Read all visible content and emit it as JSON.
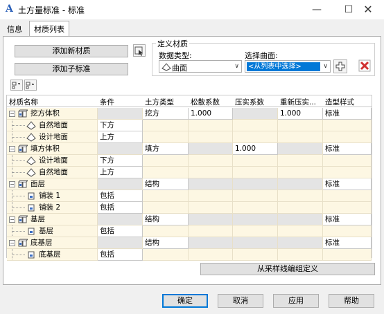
{
  "window": {
    "title": "土方量标准 - 标准",
    "min": "—",
    "max": "☐",
    "close": "✕"
  },
  "tabs": [
    {
      "label": "信息"
    },
    {
      "label": "材质列表"
    }
  ],
  "buttons": {
    "add_material": "添加新材质",
    "add_sub": "添加子标准",
    "define_from_sample": "从采样线编组定义"
  },
  "define": {
    "group_label": "定义材质",
    "datatype_label": "数据类型:",
    "datatype_value": "曲面",
    "select_label": "选择曲面:",
    "select_value": "<从列表中选择>"
  },
  "columns": [
    "材质名称",
    "条件",
    "土方类型",
    "松散系数",
    "压实系数",
    "重新压实...",
    "造型样式"
  ],
  "rows": [
    {
      "level": 0,
      "name": "挖方体积",
      "condition": "",
      "type": "挖方",
      "loose": "1.000",
      "compact": "",
      "recompact": "1.000",
      "style": "标准"
    },
    {
      "level": 1,
      "name": "自然地面",
      "condition": "下方"
    },
    {
      "level": 1,
      "name": "设计地面",
      "condition": "上方"
    },
    {
      "level": 0,
      "name": "填方体积",
      "condition": "",
      "type": "填方",
      "loose": "",
      "compact": "1.000",
      "recompact": "",
      "style": "标准"
    },
    {
      "level": 1,
      "name": "设计地面",
      "condition": "下方"
    },
    {
      "level": 1,
      "name": "自然地面",
      "condition": "上方"
    },
    {
      "level": 0,
      "name": "面层",
      "condition": "",
      "type": "结构",
      "loose": "",
      "compact": "",
      "recompact": "",
      "style": "标准"
    },
    {
      "level": 2,
      "name": "铺装 1",
      "condition": "包括"
    },
    {
      "level": 2,
      "name": "铺装 2",
      "condition": "包括"
    },
    {
      "level": 0,
      "name": "基层",
      "condition": "",
      "type": "结构",
      "loose": "",
      "compact": "",
      "recompact": "",
      "style": "标准"
    },
    {
      "level": 2,
      "name": "基层",
      "condition": "包括"
    },
    {
      "level": 0,
      "name": "底基层",
      "condition": "",
      "type": "结构",
      "loose": "",
      "compact": "",
      "recompact": "",
      "style": "标准"
    },
    {
      "level": 2,
      "name": "底基层",
      "condition": "包括"
    }
  ],
  "footer": {
    "ok": "确定",
    "cancel": "取消",
    "apply": "应用",
    "help": "帮助"
  },
  "colors": {
    "accent": "#0078d7",
    "row_yellow": "#fdf7e3",
    "cell_gray": "#e4e4e4",
    "remove_red": "#d03030"
  },
  "icons": [
    "app-icon",
    "pick-icon",
    "sort-icon",
    "cube-icon",
    "surface-icon",
    "sub-layer-icon",
    "add-icon",
    "remove-icon",
    "chevron-down-icon"
  ]
}
